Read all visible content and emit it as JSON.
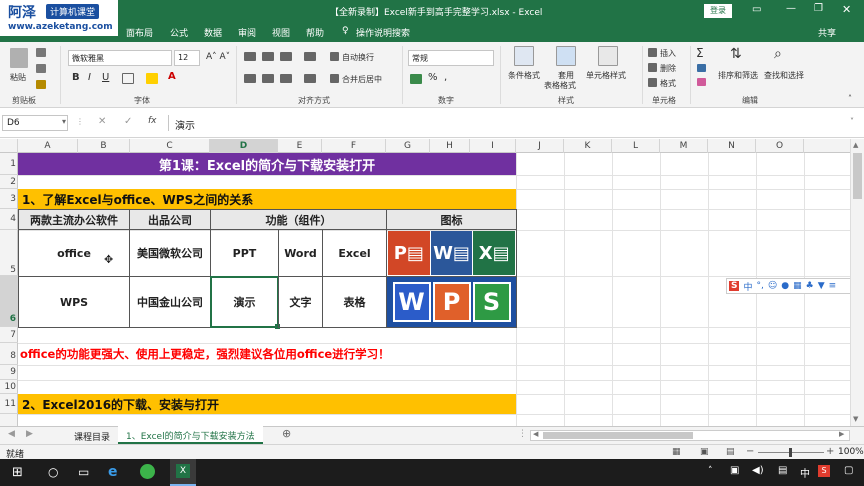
{
  "watermark": {
    "brand": "阿泽",
    "badge": "计算机课堂",
    "url": "www.azeketang.com"
  },
  "window": {
    "title": "【全新录制】Excel新手到高手完整学习.xlsx  -  Excel",
    "login": "登录"
  },
  "ribbon_tabs": [
    "面布局",
    "公式",
    "数据",
    "审阅",
    "视图",
    "帮助"
  ],
  "tell_me": "操作说明搜索",
  "share": "共享",
  "ribbon": {
    "paste": "粘贴",
    "clipboard": "剪贴板",
    "font_name": "微软雅黑",
    "font_size": "12",
    "font_group": "字体",
    "wrap": "自动换行",
    "merge": "合并后居中",
    "align_group": "对齐方式",
    "numfmt": "常规",
    "number_group": "数字",
    "cond": "条件格式",
    "table1": "套用",
    "table2": "表格格式",
    "cellstyle": "单元格样式",
    "styles_group": "样式",
    "insert": "插入",
    "delete": "删除",
    "format": "格式",
    "cells_group": "单元格",
    "sort": "排序和筛选",
    "find": "查找和选择",
    "edit_group": "编辑"
  },
  "formula": {
    "namebox": "D6",
    "fx": "fx",
    "value": "演示"
  },
  "columns": [
    "A",
    "B",
    "C",
    "D",
    "E",
    "F",
    "G",
    "H",
    "I",
    "J",
    "K",
    "L",
    "M",
    "N",
    "O"
  ],
  "rows": [
    "1",
    "2",
    "3",
    "4",
    "5",
    "6",
    "7",
    "8",
    "9",
    "10",
    "11"
  ],
  "sheet": {
    "title": "第1课：Excel的简介与下载安装打开",
    "section1": "1、了解Excel与office、WPS之间的关系",
    "headers": [
      "两款主流办公软件",
      "出品公司",
      "功能（组件）",
      "图标"
    ],
    "office_row": [
      "office",
      "美国微软公司",
      "PPT",
      "Word",
      "Excel"
    ],
    "wps_row": [
      "WPS",
      "中国金山公司",
      "演示",
      "文字",
      "表格"
    ],
    "note": "office的功能更强大、使用上更稳定，强烈建议各位用office进行学习！",
    "section2": "2、Excel2016的下载、安装与打开"
  },
  "sheet_tabs": [
    "课程目录",
    "1、Excel的简介与下载安装方法"
  ],
  "status": {
    "ready": "就绪",
    "zoom": "100%"
  },
  "colors": {
    "purple": "#7030A0",
    "orange": "#FFC000",
    "red": "#FF0000",
    "excel_green": "#217346"
  }
}
